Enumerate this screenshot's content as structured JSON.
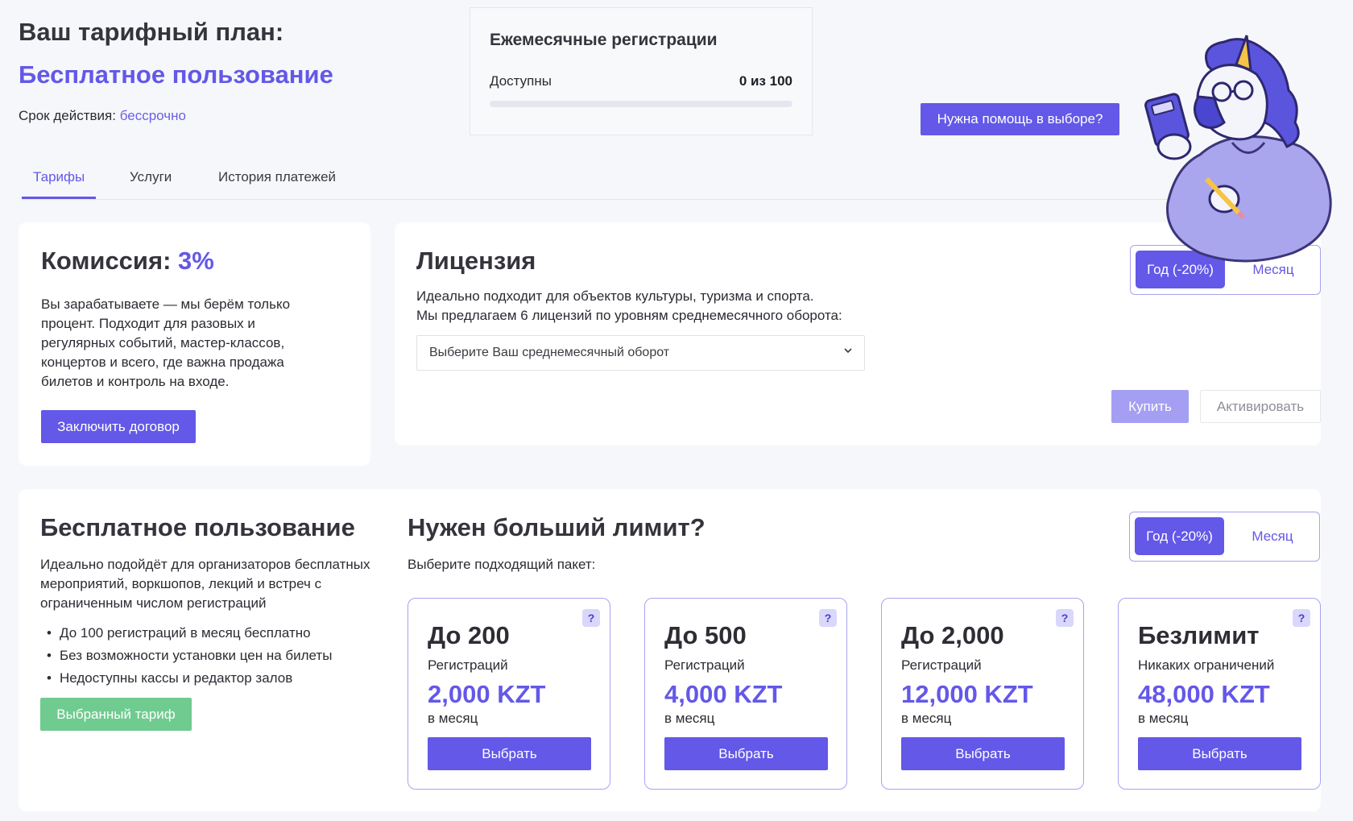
{
  "header": {
    "plan_label": "Ваш тарифный план:",
    "plan_name": "Бесплатное пользование",
    "validity_label": "Срок действия:",
    "validity_value": "бессрочно"
  },
  "registrations": {
    "title": "Ежемесячные регистрации",
    "available_label": "Доступны",
    "available_value": "0 из 100",
    "progress_fraction": 0
  },
  "help_button": "Нужна помощь в выборе?",
  "tabs": [
    {
      "label": "Тарифы",
      "active": true
    },
    {
      "label": "Услуги",
      "active": false
    },
    {
      "label": "История платежей",
      "active": false
    }
  ],
  "commission": {
    "title_prefix": "Комиссия:",
    "title_value": "3%",
    "description": "Вы зарабатываете — мы берём только процент. Подходит для разовых и регулярных событий, мастер-классов, концертов и всего, где важна продажа билетов и контроль на входе.",
    "button": "Заключить договор"
  },
  "license": {
    "title": "Лицензия",
    "line1": "Идеально подходит для объектов культуры, туризма и спорта.",
    "line2": "Мы предлагаем 6 лицензий по уровням среднемесячного оборота:",
    "select_value": "Выберите Ваш среднемесячный оборот",
    "toggle_year": "Год (-20%)",
    "toggle_month": "Месяц",
    "buy_button": "Купить",
    "activate_button": "Активировать"
  },
  "free_plan": {
    "title": "Бесплатное пользование",
    "description": "Идеально подойдёт для организаторов бесплатных мероприятий, воркшопов, лекций и встреч с ограниченным числом регистраций",
    "bullets": [
      "До 100 регистраций в месяц бесплатно",
      "Без возможности установки цен на билеты",
      "Недоступны кассы и редактор залов"
    ],
    "selected_button": "Выбранный тариф"
  },
  "limit": {
    "title": "Нужен больший лимит?",
    "subtitle": "Выберите подходящий пакет:",
    "toggle_year": "Год (-20%)",
    "toggle_month": "Месяц",
    "packages": [
      {
        "title": "До 200",
        "sub": "Регистраций",
        "price": "2,000 KZT",
        "per": "в месяц",
        "button": "Выбрать",
        "help": "?"
      },
      {
        "title": "До 500",
        "sub": "Регистраций",
        "price": "4,000 KZT",
        "per": "в месяц",
        "button": "Выбрать",
        "help": "?"
      },
      {
        "title": "До 2,000",
        "sub": "Регистраций",
        "price": "12,000 KZT",
        "per": "в месяц",
        "button": "Выбрать",
        "help": "?"
      },
      {
        "title": "Безлимит",
        "sub": "Никаких ограничений",
        "price": "48,000 KZT",
        "per": "в месяц",
        "button": "Выбрать",
        "help": "?"
      }
    ]
  },
  "colors": {
    "accent": "#6358e8",
    "accent_light": "#a49ff3",
    "success": "#6fcb8f",
    "background": "#f6f7fa"
  }
}
